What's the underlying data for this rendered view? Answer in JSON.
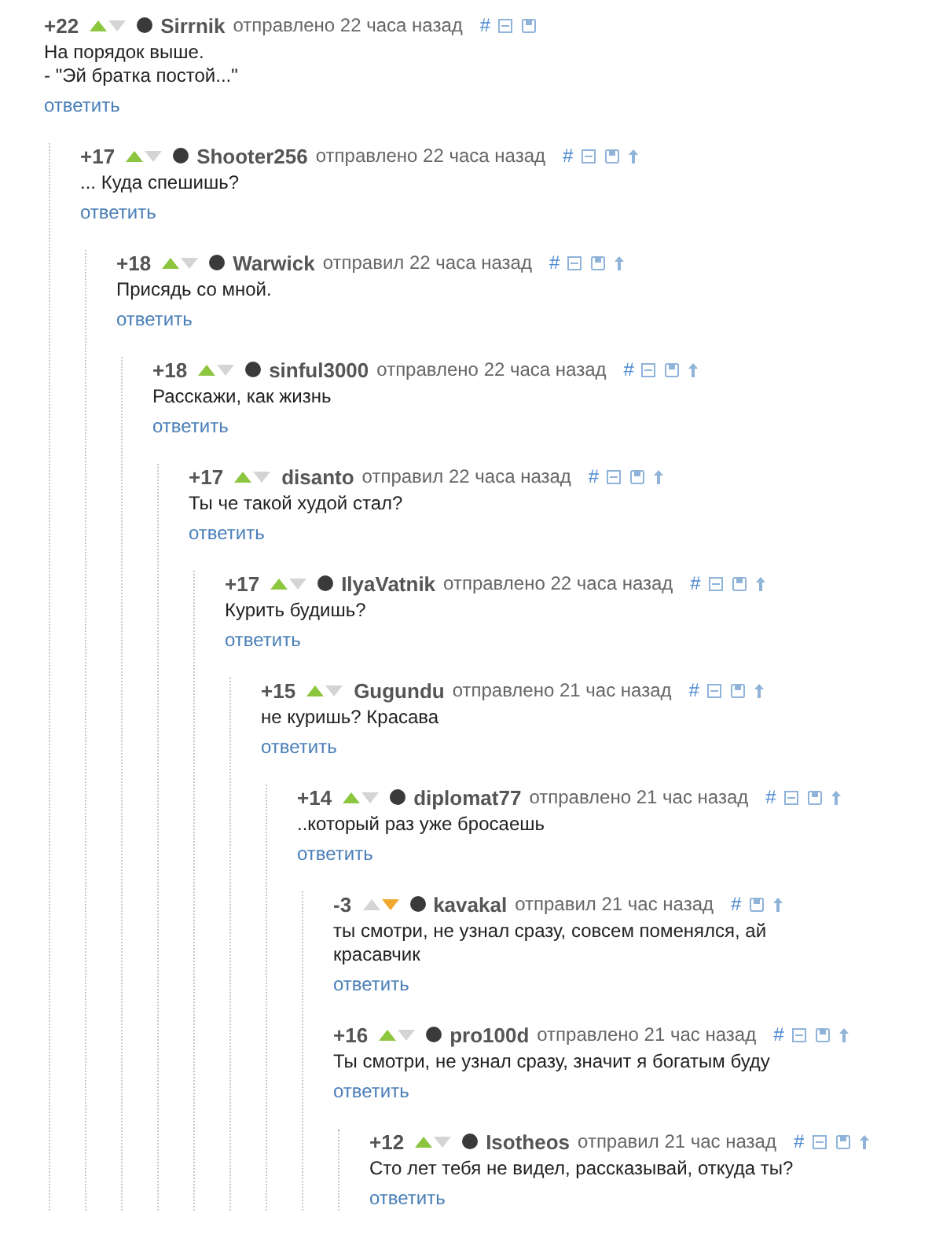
{
  "comments": [
    {
      "rating": "+22",
      "upvoted": true,
      "downvoted": false,
      "avatar": true,
      "author": "Sirrnik",
      "meta": "отправлено 22 часа назад",
      "link": "#",
      "icons": [
        {
          "kind": "collapse"
        },
        {
          "kind": "save"
        }
      ],
      "lines": [
        "На порядок выше.",
        "- \"Эй братка постой...\""
      ],
      "reply": "ответить",
      "children": [
        {
          "rating": "+17",
          "upvoted": true,
          "downvoted": false,
          "avatar": true,
          "author": "Shooter256",
          "meta": "отправлено 22 часа назад",
          "link": "#",
          "icons": [
            {
              "kind": "collapse"
            },
            {
              "kind": "save"
            },
            {
              "kind": "up"
            }
          ],
          "lines": [
            "... Куда спешишь?"
          ],
          "reply": "ответить",
          "children": [
            {
              "rating": "+18",
              "upvoted": true,
              "downvoted": false,
              "avatar": true,
              "author": "Warwick",
              "meta": "отправил 22 часа назад",
              "link": "#",
              "icons": [
                {
                  "kind": "collapse"
                },
                {
                  "kind": "save"
                },
                {
                  "kind": "up"
                }
              ],
              "lines": [
                "Присядь со мной."
              ],
              "reply": "ответить",
              "children": [
                {
                  "rating": "+18",
                  "upvoted": true,
                  "downvoted": false,
                  "avatar": true,
                  "author": "sinful3000",
                  "meta": "отправлено 22 часа назад",
                  "link": "#",
                  "icons": [
                    {
                      "kind": "collapse"
                    },
                    {
                      "kind": "save"
                    },
                    {
                      "kind": "up"
                    }
                  ],
                  "lines": [
                    "Расскажи, как жизнь"
                  ],
                  "reply": "ответить",
                  "children": [
                    {
                      "rating": "+17",
                      "upvoted": true,
                      "downvoted": false,
                      "avatar": false,
                      "author": "disanto",
                      "meta": "отправил 22 часа назад",
                      "link": "#",
                      "icons": [
                        {
                          "kind": "collapse"
                        },
                        {
                          "kind": "save"
                        },
                        {
                          "kind": "up"
                        }
                      ],
                      "lines": [
                        "Ты че такой худой стал?"
                      ],
                      "reply": "ответить",
                      "children": [
                        {
                          "rating": "+17",
                          "upvoted": true,
                          "downvoted": false,
                          "avatar": true,
                          "author": "IlyaVatnik",
                          "meta": "отправлено 22 часа назад",
                          "link": "#",
                          "icons": [
                            {
                              "kind": "collapse"
                            },
                            {
                              "kind": "save"
                            },
                            {
                              "kind": "up"
                            }
                          ],
                          "lines": [
                            "Курить будишь?"
                          ],
                          "reply": "ответить",
                          "children": [
                            {
                              "rating": "+15",
                              "upvoted": true,
                              "downvoted": false,
                              "avatar": false,
                              "author": "Gugundu",
                              "meta": "отправлено 21 час назад",
                              "link": "#",
                              "icons": [
                                {
                                  "kind": "collapse"
                                },
                                {
                                  "kind": "save"
                                },
                                {
                                  "kind": "up"
                                }
                              ],
                              "lines": [
                                "не куришь? Красава"
                              ],
                              "reply": "ответить",
                              "children": [
                                {
                                  "rating": "+14",
                                  "upvoted": true,
                                  "downvoted": false,
                                  "avatar": true,
                                  "author": "diplomat77",
                                  "meta": "отправлено 21 час назад",
                                  "link": "#",
                                  "icons": [
                                    {
                                      "kind": "collapse"
                                    },
                                    {
                                      "kind": "save"
                                    },
                                    {
                                      "kind": "up"
                                    }
                                  ],
                                  "lines": [
                                    "..который раз уже бросаешь"
                                  ],
                                  "reply": "ответить",
                                  "children": [
                                    {
                                      "rating": "-3",
                                      "upvoted": false,
                                      "downvoted": true,
                                      "avatar": true,
                                      "author": "kavakal",
                                      "meta": "отправил 21 час назад",
                                      "link": "#",
                                      "icons": [
                                        {
                                          "kind": "save"
                                        },
                                        {
                                          "kind": "up"
                                        }
                                      ],
                                      "lines": [
                                        "ты смотри, не узнал сразу, совсем поменялся, ай красавчик"
                                      ],
                                      "reply": "ответить"
                                    },
                                    {
                                      "rating": "+16",
                                      "upvoted": true,
                                      "downvoted": false,
                                      "avatar": true,
                                      "author": "pro100d",
                                      "meta": "отправлено 21 час назад",
                                      "link": "#",
                                      "icons": [
                                        {
                                          "kind": "collapse"
                                        },
                                        {
                                          "kind": "save"
                                        },
                                        {
                                          "kind": "up"
                                        }
                                      ],
                                      "lines": [
                                        "Ты смотри, не узнал сразу, значит я богатым буду"
                                      ],
                                      "reply": "ответить",
                                      "children": [
                                        {
                                          "rating": "+12",
                                          "upvoted": true,
                                          "downvoted": false,
                                          "avatar": true,
                                          "author": "Isotheos",
                                          "meta": "отправил 21 час назад",
                                          "link": "#",
                                          "icons": [
                                            {
                                              "kind": "collapse"
                                            },
                                            {
                                              "kind": "save"
                                            },
                                            {
                                              "kind": "up"
                                            }
                                          ],
                                          "lines": [
                                            "Сто лет тебя не видел, рассказывай, откуда ты?"
                                          ],
                                          "reply": "ответить"
                                        }
                                      ]
                                    }
                                  ]
                                }
                              ]
                            }
                          ]
                        }
                      ]
                    }
                  ]
                }
              ]
            }
          ]
        }
      ]
    }
  ]
}
